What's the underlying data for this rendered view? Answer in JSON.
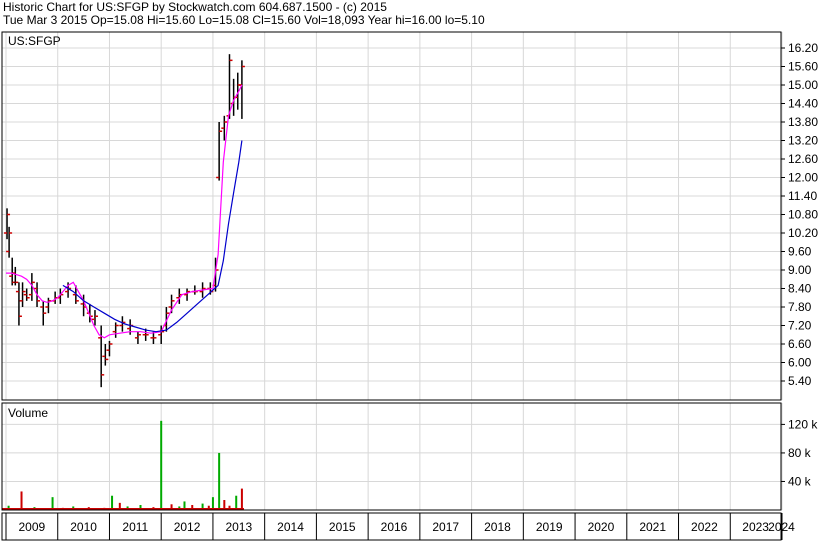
{
  "header": {
    "title": "Historic Chart for US:SFGP by Stockwatch.com 604.687.1500 - (c) 2015",
    "quote": "Tue Mar  3 2015   Op=15.08   Hi=15.60   Lo=15.08   Cl=15.60   Vol=18,093   Year hi=16.00   lo=5.10"
  },
  "colors": {
    "ma_short": "#ff00ff",
    "ma_long": "#0000cc",
    "up_bar": "#000000",
    "down_tick": "#cc0000",
    "vol_up": "#00aa00",
    "vol_down": "#cc0000",
    "grid": "#d8d8d8"
  },
  "chart_data": [
    {
      "type": "line",
      "title": "US:SFGP",
      "ylim": [
        5.1,
        16.3
      ],
      "yticks": [
        "16.20",
        "15.60",
        "15.00",
        "14.40",
        "13.80",
        "13.20",
        "12.60",
        "12.00",
        "11.40",
        "10.80",
        "10.20",
        "9.60",
        "9.00",
        "8.40",
        "7.80",
        "7.20",
        "6.60",
        "6.00",
        "5.40"
      ],
      "xticks": [
        "2009",
        "2010",
        "2011",
        "2012",
        "2013",
        "2014",
        "2015",
        "2016",
        "2017",
        "2018",
        "2019",
        "2020",
        "2021",
        "2022",
        "2023",
        "2024"
      ],
      "xlim": [
        2009.0,
        2024.5
      ],
      "grid": true,
      "series": [
        {
          "kind": "ohlc",
          "points": [
            [
              2009.02,
              10.2,
              11.0,
              10.0,
              10.8
            ],
            [
              2009.06,
              9.6,
              10.4,
              9.4,
              10.2
            ],
            [
              2009.12,
              8.8,
              9.4,
              8.5,
              8.6
            ],
            [
              2009.18,
              8.9,
              9.1,
              8.5,
              8.6
            ],
            [
              2009.25,
              8.3,
              8.6,
              7.2,
              7.5
            ],
            [
              2009.32,
              8.0,
              8.6,
              7.8,
              8.3
            ],
            [
              2009.4,
              8.2,
              8.4,
              8.0,
              8.1
            ],
            [
              2009.5,
              8.2,
              8.9,
              8.0,
              8.6
            ],
            [
              2009.6,
              8.4,
              8.6,
              7.8,
              8.0
            ],
            [
              2009.72,
              7.8,
              8.0,
              7.2,
              7.6
            ],
            [
              2009.82,
              7.8,
              8.1,
              7.6,
              8.0
            ],
            [
              2009.95,
              8.0,
              8.3,
              7.9,
              8.1
            ],
            [
              2010.05,
              8.1,
              8.4,
              7.9,
              8.2
            ],
            [
              2010.2,
              8.3,
              8.6,
              8.1,
              8.4
            ],
            [
              2010.35,
              8.2,
              8.5,
              7.9,
              8.0
            ],
            [
              2010.5,
              7.9,
              8.2,
              7.5,
              7.8
            ],
            [
              2010.62,
              7.6,
              7.9,
              7.3,
              7.5
            ],
            [
              2010.72,
              7.4,
              7.7,
              7.2,
              7.5
            ],
            [
              2010.84,
              6.8,
              7.2,
              5.2,
              5.6
            ],
            [
              2010.92,
              6.2,
              6.6,
              5.9,
              6.1
            ],
            [
              2011.0,
              6.4,
              6.7,
              6.2,
              6.6
            ],
            [
              2011.12,
              7.0,
              7.3,
              6.8,
              7.2
            ],
            [
              2011.25,
              7.2,
              7.5,
              7.0,
              7.3
            ],
            [
              2011.4,
              7.1,
              7.4,
              6.9,
              7.2
            ],
            [
              2011.55,
              6.8,
              7.0,
              6.6,
              6.9
            ],
            [
              2011.7,
              6.9,
              7.1,
              6.7,
              6.9
            ],
            [
              2011.85,
              6.8,
              7.0,
              6.6,
              6.8
            ],
            [
              2012.0,
              6.9,
              7.2,
              6.6,
              7.0
            ],
            [
              2012.1,
              7.2,
              7.8,
              7.0,
              7.6
            ],
            [
              2012.2,
              7.8,
              8.2,
              7.6,
              8.0
            ],
            [
              2012.35,
              8.1,
              8.4,
              7.9,
              8.2
            ],
            [
              2012.5,
              8.2,
              8.4,
              8.0,
              8.3
            ],
            [
              2012.65,
              8.3,
              8.5,
              8.2,
              8.3
            ],
            [
              2012.8,
              8.3,
              8.6,
              8.1,
              8.4
            ],
            [
              2012.95,
              8.4,
              8.6,
              8.2,
              8.3
            ],
            [
              2013.05,
              8.5,
              9.4,
              8.3,
              9.0
            ],
            [
              2013.12,
              12.0,
              13.8,
              11.9,
              13.5
            ],
            [
              2013.22,
              13.6,
              14.0,
              13.2,
              13.8
            ],
            [
              2013.32,
              14.0,
              16.0,
              13.9,
              15.8
            ],
            [
              2013.4,
              14.4,
              15.2,
              14.0,
              14.6
            ],
            [
              2013.48,
              14.6,
              15.4,
              14.2,
              15.0
            ],
            [
              2013.56,
              15.0,
              15.8,
              13.9,
              15.6
            ]
          ]
        },
        {
          "name": "",
          "kind": "ma_short",
          "x": [
            2009.0,
            2009.1,
            2009.2,
            2009.3,
            2009.4,
            2009.5,
            2009.6,
            2009.7,
            2009.8,
            2009.9,
            2010.0,
            2010.1,
            2010.2,
            2010.3,
            2010.4,
            2010.5,
            2010.6,
            2010.7,
            2010.8,
            2010.9,
            2011.0,
            2011.2,
            2011.4,
            2011.6,
            2011.8,
            2012.0,
            2012.2,
            2012.4,
            2012.6,
            2012.8,
            2013.0,
            2013.1,
            2013.2,
            2013.3,
            2013.4,
            2013.5,
            2013.56
          ],
          "y": [
            8.9,
            8.9,
            8.85,
            8.8,
            8.7,
            8.5,
            8.2,
            8.0,
            7.95,
            8.0,
            8.1,
            8.3,
            8.5,
            8.6,
            8.3,
            8.0,
            7.6,
            7.2,
            6.9,
            6.8,
            6.9,
            6.95,
            7.0,
            7.0,
            6.95,
            7.0,
            7.7,
            8.2,
            8.3,
            8.35,
            8.4,
            9.5,
            12.5,
            14.0,
            14.5,
            14.8,
            15.0
          ]
        },
        {
          "name": "",
          "kind": "ma_long",
          "x": [
            2010.1,
            2010.3,
            2010.5,
            2010.7,
            2010.9,
            2011.1,
            2011.3,
            2011.5,
            2011.7,
            2011.9,
            2012.1,
            2012.3,
            2012.5,
            2012.7,
            2012.9,
            2013.0,
            2013.1,
            2013.2,
            2013.3,
            2013.4,
            2013.5,
            2013.56
          ],
          "y": [
            8.5,
            8.3,
            8.0,
            7.8,
            7.6,
            7.4,
            7.25,
            7.15,
            7.05,
            7.0,
            7.05,
            7.3,
            7.6,
            7.9,
            8.2,
            8.35,
            8.5,
            9.3,
            10.5,
            11.5,
            12.5,
            13.2
          ]
        }
      ]
    },
    {
      "type": "bar",
      "title": "Volume",
      "yticks": [
        "120 k",
        "80 k",
        "40 k"
      ],
      "ylim": [
        0,
        150000
      ],
      "grid": true,
      "series": [
        {
          "name": "",
          "x": [
            2009.05,
            2009.3,
            2009.55,
            2009.9,
            2010.1,
            2010.3,
            2010.6,
            2010.9,
            2011.05,
            2011.2,
            2011.35,
            2011.6,
            2011.85,
            2012.0,
            2012.2,
            2012.35,
            2012.45,
            2012.6,
            2012.8,
            2012.92,
            2013.0,
            2013.12,
            2013.22,
            2013.32,
            2013.45,
            2013.56
          ],
          "values": [
            6000,
            26000,
            4000,
            18000,
            3000,
            5000,
            4000,
            3000,
            20000,
            10000,
            5000,
            7000,
            4000,
            125000,
            8000,
            5000,
            12000,
            7000,
            9000,
            6000,
            18000,
            80000,
            14000,
            6000,
            20000,
            30000
          ],
          "up": [
            true,
            false,
            true,
            true,
            false,
            true,
            false,
            false,
            true,
            false,
            true,
            true,
            false,
            true,
            false,
            true,
            true,
            false,
            true,
            false,
            true,
            true,
            false,
            false,
            true,
            false
          ]
        }
      ]
    }
  ]
}
